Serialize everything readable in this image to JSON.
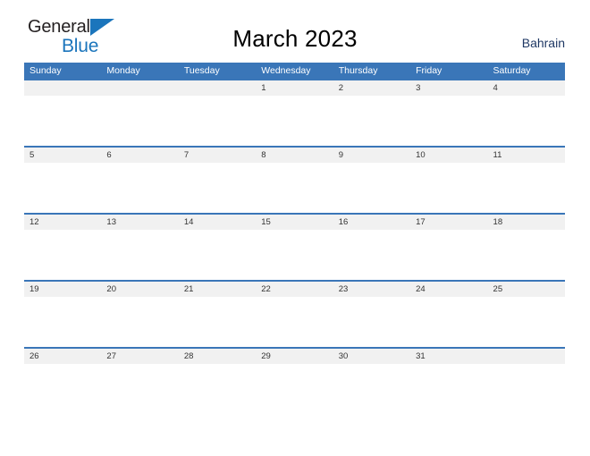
{
  "logo": {
    "word_top": "General",
    "word_bottom": "Blue",
    "triangle_icon": "blue-triangle-icon",
    "color_dark": "#231f20",
    "color_blue": "#1b75bc"
  },
  "header": {
    "title": "March 2023",
    "locale": "Bahrain",
    "locale_color": "#1f3864"
  },
  "calendar": {
    "header_bg": "#3a76b8",
    "row_band_bg": "#f1f1f1",
    "weekdays": [
      "Sunday",
      "Monday",
      "Tuesday",
      "Wednesday",
      "Thursday",
      "Friday",
      "Saturday"
    ],
    "weeks": [
      {
        "days": [
          "",
          "",
          "",
          "1",
          "2",
          "3",
          "4"
        ]
      },
      {
        "days": [
          "5",
          "6",
          "7",
          "8",
          "9",
          "10",
          "11"
        ]
      },
      {
        "days": [
          "12",
          "13",
          "14",
          "15",
          "16",
          "17",
          "18"
        ]
      },
      {
        "days": [
          "19",
          "20",
          "21",
          "22",
          "23",
          "24",
          "25"
        ]
      },
      {
        "days": [
          "26",
          "27",
          "28",
          "29",
          "30",
          "31",
          ""
        ]
      }
    ]
  }
}
